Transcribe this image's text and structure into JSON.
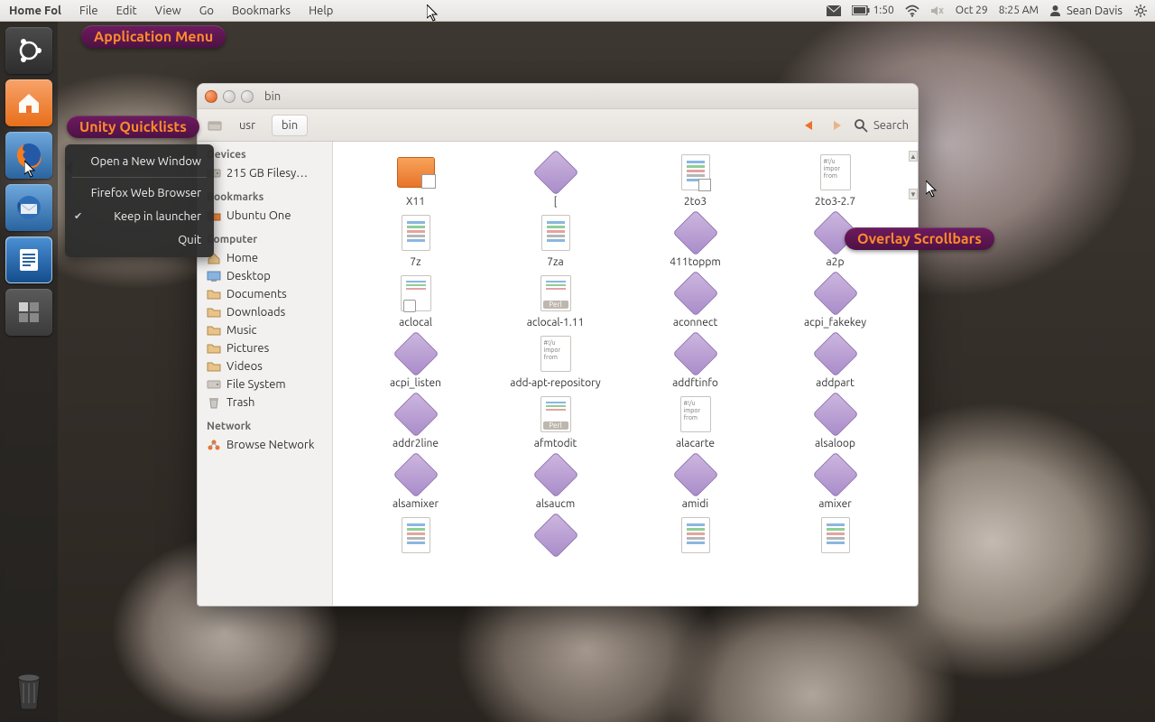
{
  "panel": {
    "app": "Home Fol",
    "menus": [
      "File",
      "Edit",
      "View",
      "Go",
      "Bookmarks",
      "Help"
    ],
    "battery_time": "1:50",
    "date": "Oct 29",
    "time": "8:25 AM",
    "user": "Sean Davis"
  },
  "callouts": {
    "app_menu": "Application Menu",
    "quicklists": "Unity Quicklists",
    "scrollbars": "Overlay Scrollbars"
  },
  "quicklist": {
    "items": [
      {
        "label": "Open a New Window",
        "check": false
      },
      {
        "label": "Firefox Web Browser",
        "check": false
      },
      {
        "label": "Keep in launcher",
        "check": true
      },
      {
        "label": "Quit",
        "check": false
      }
    ]
  },
  "launcher": [
    {
      "name": "ubuntu-dash",
      "tile": "tile-dark"
    },
    {
      "name": "home-folder",
      "tile": "tile-orange"
    },
    {
      "name": "firefox",
      "tile": "tile-blue"
    },
    {
      "name": "thunderbird",
      "tile": "tile-blue"
    },
    {
      "name": "libreoffice-writer",
      "tile": "tile-blue2"
    },
    {
      "name": "workspace-switcher",
      "tile": "tile-grey"
    }
  ],
  "window": {
    "title": "bin",
    "path": [
      "usr",
      "bin"
    ],
    "search_label": "Search",
    "sidebar": {
      "devices_head": "Devices",
      "devices": [
        {
          "label": "215 GB Filesy…",
          "icon": "drive"
        }
      ],
      "bookmarks_head": "Bookmarks",
      "bookmarks": [
        {
          "label": "Ubuntu One",
          "icon": "folder-orange"
        }
      ],
      "computer_head": "Computer",
      "computer": [
        {
          "label": "Home",
          "icon": "home"
        },
        {
          "label": "Desktop",
          "icon": "desktop"
        },
        {
          "label": "Documents",
          "icon": "folder"
        },
        {
          "label": "Downloads",
          "icon": "folder"
        },
        {
          "label": "Music",
          "icon": "folder"
        },
        {
          "label": "Pictures",
          "icon": "folder"
        },
        {
          "label": "Videos",
          "icon": "folder"
        },
        {
          "label": "File System",
          "icon": "drive"
        },
        {
          "label": "Trash",
          "icon": "trash"
        }
      ],
      "network_head": "Network",
      "network": [
        {
          "label": "Browse Network",
          "icon": "network"
        }
      ]
    },
    "files": [
      {
        "name": "X11",
        "type": "folder"
      },
      {
        "name": "[",
        "type": "diamond"
      },
      {
        "name": "2to3",
        "type": "text",
        "shortcut": true
      },
      {
        "name": "2to3-2.7",
        "type": "script"
      },
      {
        "name": "7z",
        "type": "text"
      },
      {
        "name": "7za",
        "type": "text"
      },
      {
        "name": "411toppm",
        "type": "diamond"
      },
      {
        "name": "a2p",
        "type": "diamond"
      },
      {
        "name": "aclocal",
        "type": "perl",
        "shortcut": true
      },
      {
        "name": "aclocal-1.11",
        "type": "perl"
      },
      {
        "name": "aconnect",
        "type": "diamond"
      },
      {
        "name": "acpi_fakekey",
        "type": "diamond"
      },
      {
        "name": "acpi_listen",
        "type": "diamond"
      },
      {
        "name": "add-apt-repository",
        "type": "script"
      },
      {
        "name": "addftinfo",
        "type": "diamond"
      },
      {
        "name": "addpart",
        "type": "diamond"
      },
      {
        "name": "addr2line",
        "type": "diamond"
      },
      {
        "name": "afmtodit",
        "type": "perl"
      },
      {
        "name": "alacarte",
        "type": "script"
      },
      {
        "name": "alsaloop",
        "type": "diamond"
      },
      {
        "name": "alsamixer",
        "type": "diamond"
      },
      {
        "name": "alsaucm",
        "type": "diamond"
      },
      {
        "name": "amidi",
        "type": "diamond"
      },
      {
        "name": "amixer",
        "type": "diamond"
      },
      {
        "name": "",
        "type": "text"
      },
      {
        "name": "",
        "type": "diamond"
      },
      {
        "name": "",
        "type": "text"
      },
      {
        "name": "",
        "type": "text"
      }
    ]
  }
}
